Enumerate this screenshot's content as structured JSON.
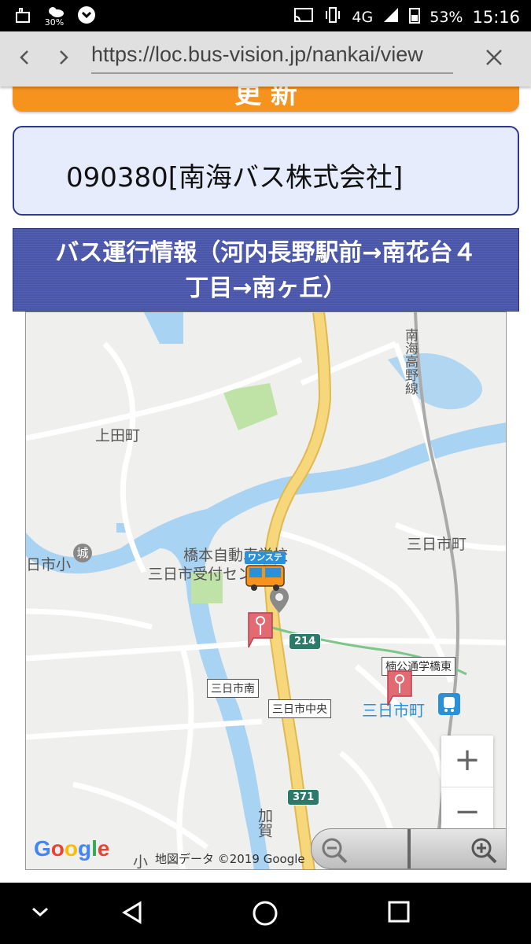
{
  "status": {
    "battery": "53%",
    "time": "15:16",
    "weather": "30%",
    "network": "4G"
  },
  "browser": {
    "url": "https://loc.bus-vision.jp/nankai/view"
  },
  "page": {
    "update_button": "更 新",
    "vehicle": "090380[南海バス株式会社]",
    "header_line1": "バス運行情報（河内長野駅前→南花台４",
    "header_line2": "丁目→南ヶ丘）"
  },
  "map": {
    "labels": {
      "ueda": "上田町",
      "mikkaichi_town": "三日市町",
      "hashimoto": "橋本自動車学校",
      "reception": "三日市受付センター",
      "mikkaichi_sho": "日市小",
      "nankai_line": "南海高野線",
      "station": "三日市町",
      "kaga": "加賀",
      "ko": "小",
      "jou": "城"
    },
    "road_214": "214",
    "road_371": "371",
    "stop_minami": "三日市南",
    "stop_chuo": "三日市中央",
    "stop_higashi": "楠公通学橋東",
    "bus_badge": "ワンステ",
    "google": "Google",
    "attribution": "地図データ ©2019 Google",
    "zoom_in": "+",
    "zoom_out": "−",
    "colors": {
      "road_main": "#f7d77b",
      "river": "#a8d3f2",
      "park": "#bfe3a6",
      "stop_pin": "#e26a72",
      "station": "#2a90d8"
    }
  }
}
